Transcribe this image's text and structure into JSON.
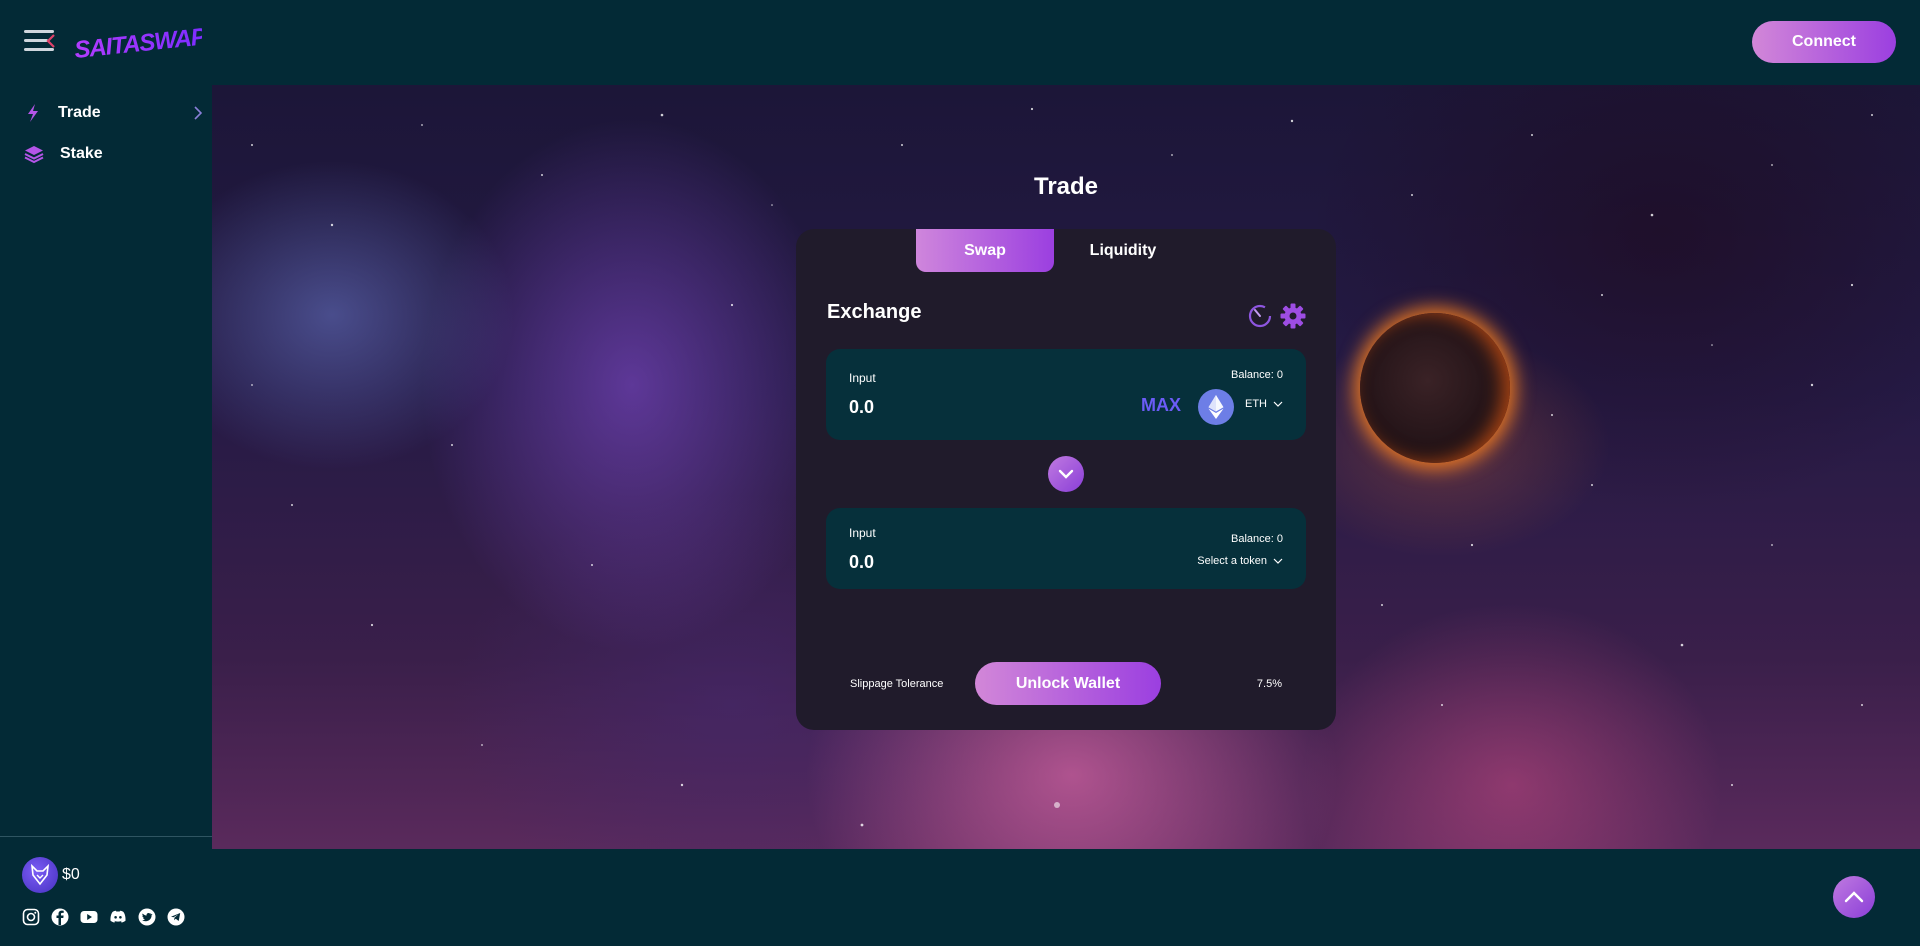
{
  "header": {
    "brand": "SAITASWAP",
    "connect_label": "Connect"
  },
  "sidebar": {
    "items": [
      {
        "label": "Trade",
        "icon": "trade-icon"
      },
      {
        "label": "Stake",
        "icon": "stake-icon"
      }
    ],
    "price": "$0",
    "socials": [
      "instagram-icon",
      "facebook-icon",
      "youtube-icon",
      "discord-icon",
      "twitter-icon",
      "telegram-icon"
    ]
  },
  "main": {
    "title": "Trade",
    "tabs": [
      {
        "label": "Swap",
        "active": true
      },
      {
        "label": "Liquidity",
        "active": false
      }
    ],
    "exchange_title": "Exchange",
    "from": {
      "label": "Input",
      "balance": "Balance: 0",
      "amount": "0.0",
      "max_label": "MAX",
      "token": "ETH"
    },
    "to": {
      "label": "Input",
      "balance": "Balance: 0",
      "amount": "0.0",
      "token_placeholder": "Select a token"
    },
    "slippage": {
      "label": "Slippage Tolerance",
      "value": "7.5%"
    },
    "unlock_label": "Unlock Wallet"
  },
  "colors": {
    "background": "#032a36",
    "card": "#201b2b",
    "panel": "#06303b",
    "accent_start": "#d287d8",
    "accent_end": "#9b3fe0",
    "max": "#6b5cf6"
  }
}
